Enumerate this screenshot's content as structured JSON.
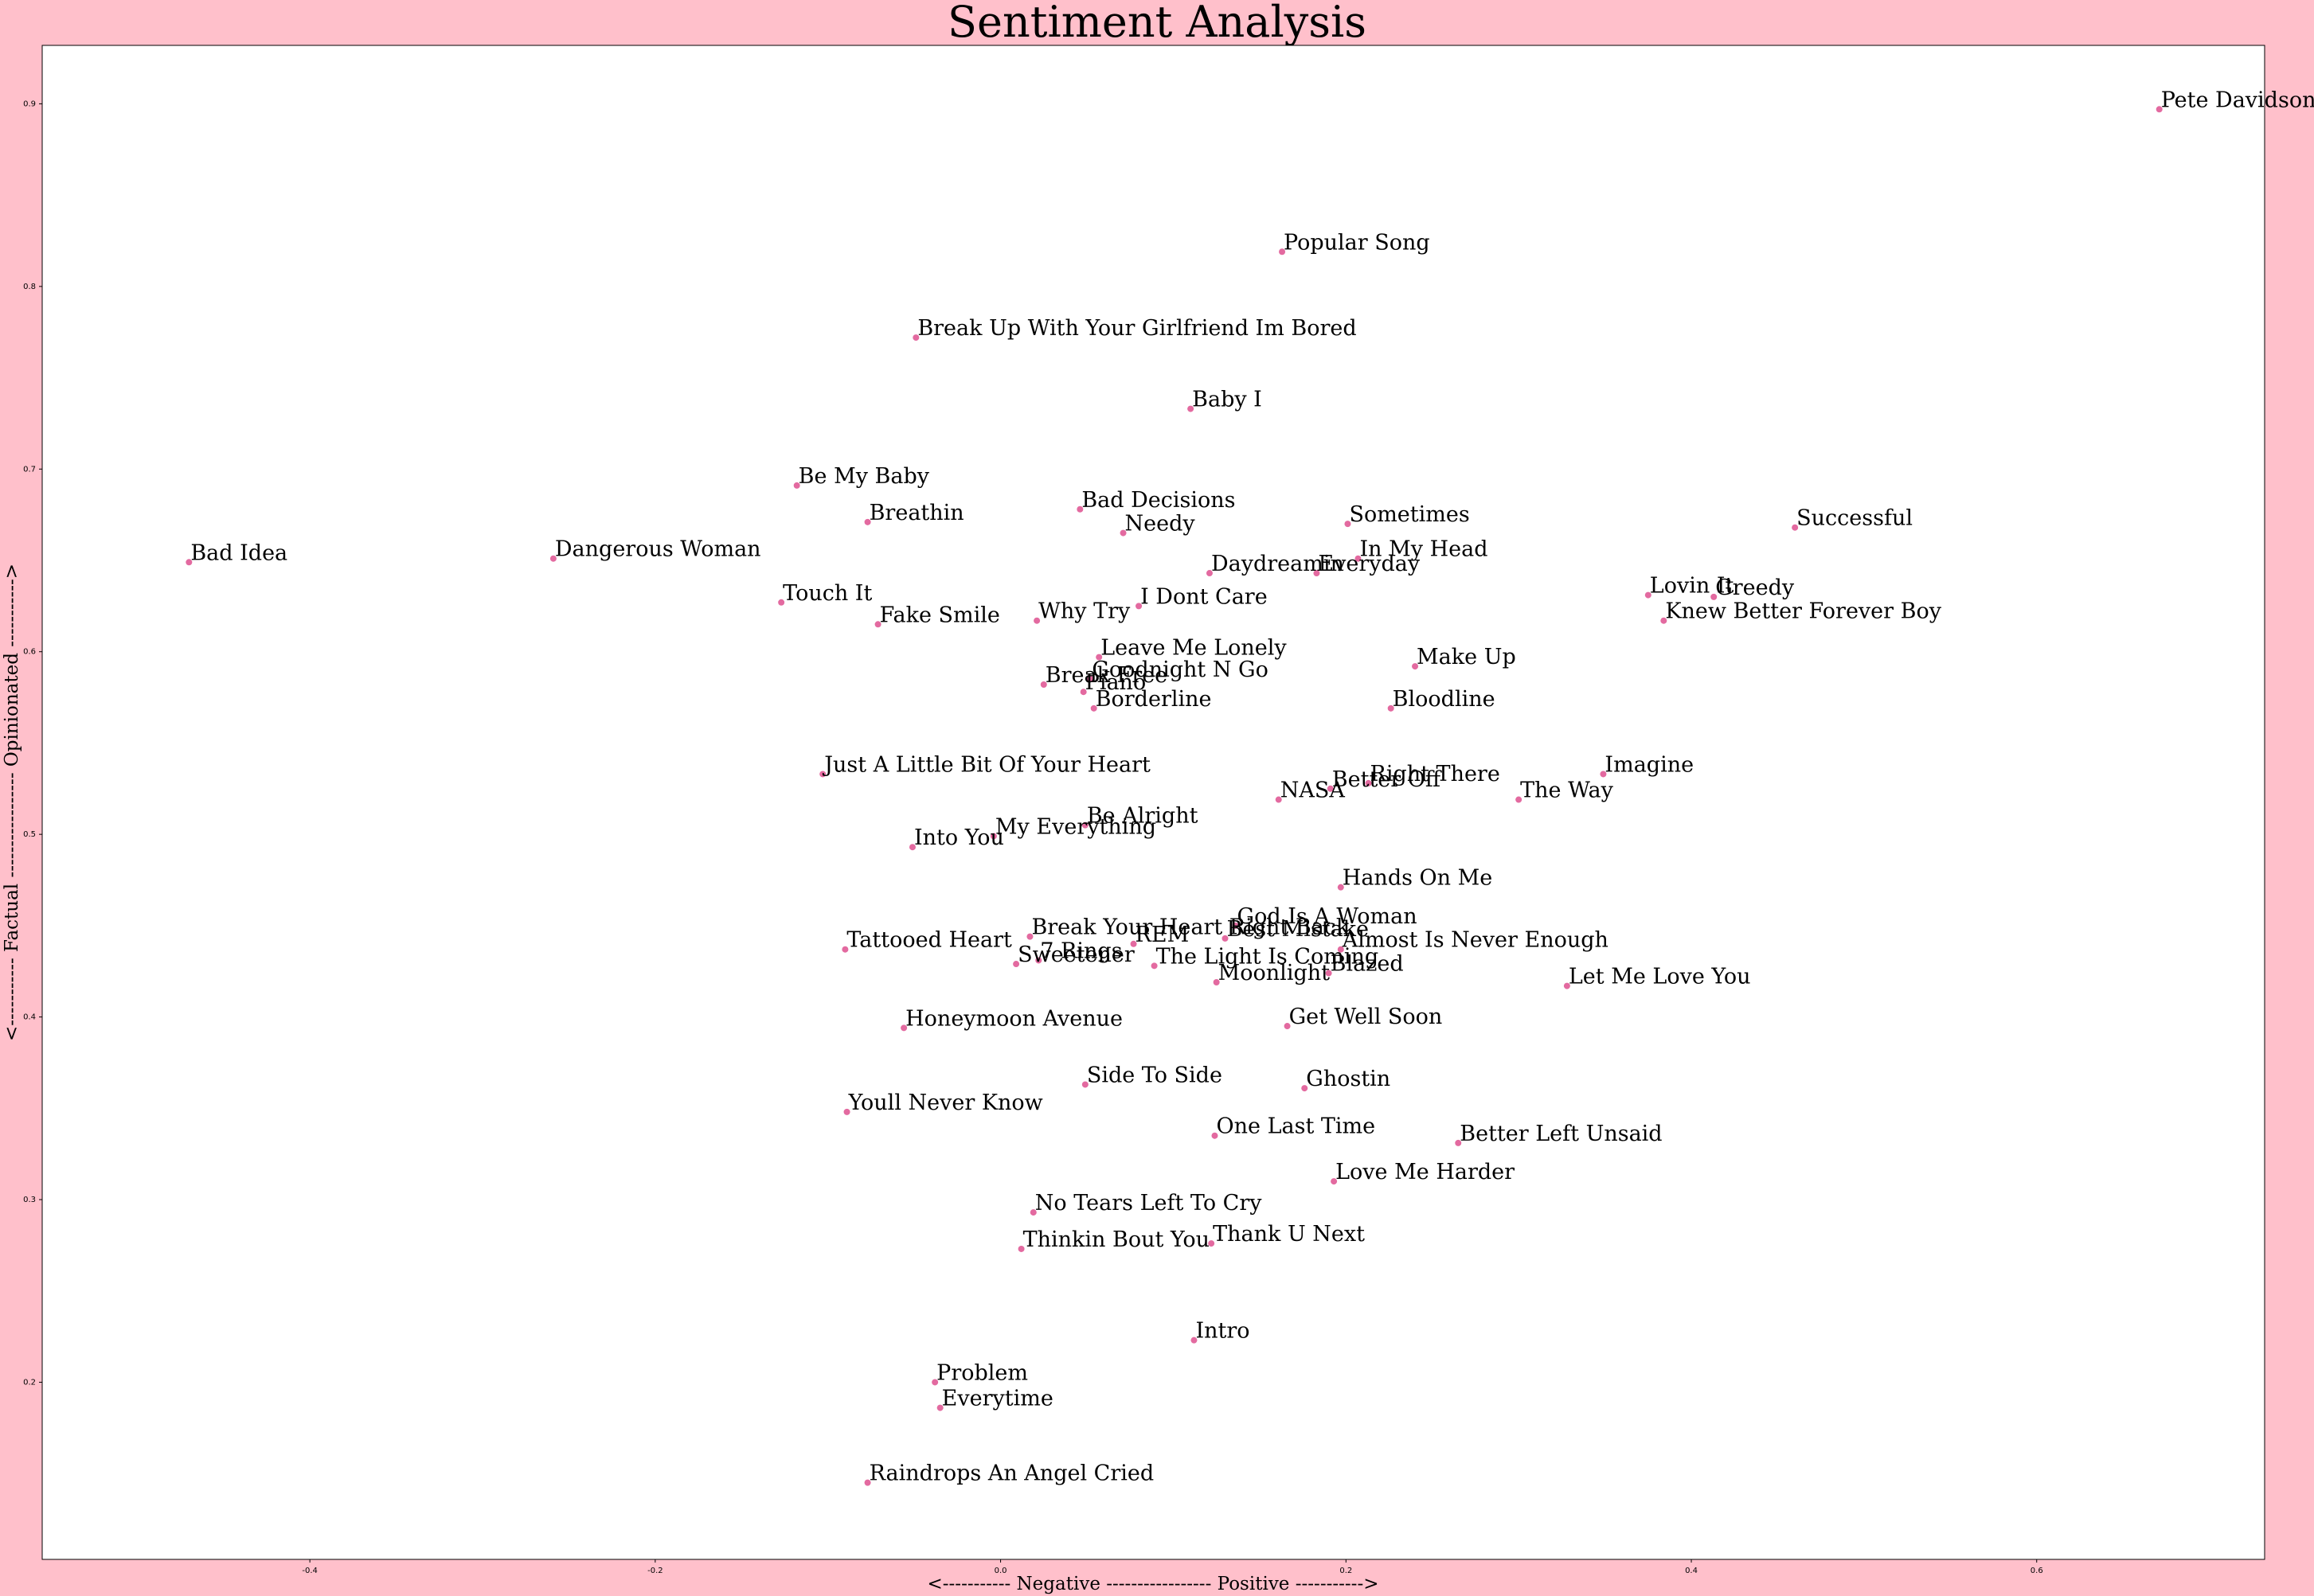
{
  "chart_data": {
    "type": "scatter",
    "title": "Sentiment Analysis",
    "xlabel": "<----------- Negative ----------------- Positive ----------->",
    "ylabel": "<----------- Factual ----------------- Opinionated ----------->",
    "xlim": [
      -0.555,
      0.732
    ],
    "ylim": [
      0.103,
      0.932
    ],
    "xticks": [
      -0.4,
      -0.2,
      0.0,
      0.2,
      0.4,
      0.6
    ],
    "xtick_labels": [
      "-0.4",
      "-0.2",
      "0.0",
      "0.2",
      "0.4",
      "0.6"
    ],
    "yticks": [
      0.2,
      0.3,
      0.4,
      0.5,
      0.6,
      0.7,
      0.8,
      0.9
    ],
    "ytick_labels": [
      "0.2",
      "0.3",
      "0.4",
      "0.5",
      "0.6",
      "0.7",
      "0.8",
      "0.9"
    ],
    "point_color": "#e36aa0",
    "background_color": "#ffc0cb",
    "plot_background": "#ffffff",
    "grid": false,
    "legend": false,
    "points": [
      {
        "label": "Pete Davidson",
        "x": 0.671,
        "y": 0.897
      },
      {
        "label": "Popular Song",
        "x": 0.163,
        "y": 0.819
      },
      {
        "label": "Break Up With Your Girlfriend Im Bored",
        "x": -0.049,
        "y": 0.772
      },
      {
        "label": "Baby I",
        "x": 0.11,
        "y": 0.733
      },
      {
        "label": "Be My Baby",
        "x": -0.118,
        "y": 0.691
      },
      {
        "label": "Breathin",
        "x": -0.077,
        "y": 0.671
      },
      {
        "label": "Bad Decisions",
        "x": 0.046,
        "y": 0.678
      },
      {
        "label": "Needy",
        "x": 0.071,
        "y": 0.665
      },
      {
        "label": "Sometimes",
        "x": 0.201,
        "y": 0.67
      },
      {
        "label": "Successful",
        "x": 0.46,
        "y": 0.668
      },
      {
        "label": "Bad Idea",
        "x": -0.47,
        "y": 0.649
      },
      {
        "label": "Dangerous Woman",
        "x": -0.259,
        "y": 0.651
      },
      {
        "label": "In My Head",
        "x": 0.207,
        "y": 0.651
      },
      {
        "label": "Daydreamin",
        "x": 0.121,
        "y": 0.643
      },
      {
        "label": "Everyday",
        "x": 0.183,
        "y": 0.643
      },
      {
        "label": "Touch It",
        "x": -0.127,
        "y": 0.627
      },
      {
        "label": "Fake Smile",
        "x": -0.071,
        "y": 0.615
      },
      {
        "label": "Why Try",
        "x": 0.021,
        "y": 0.617
      },
      {
        "label": "I Dont Care",
        "x": 0.08,
        "y": 0.625
      },
      {
        "label": "Lovin It",
        "x": 0.375,
        "y": 0.631
      },
      {
        "label": "Greedy",
        "x": 0.413,
        "y": 0.63
      },
      {
        "label": "Knew Better Forever Boy",
        "x": 0.384,
        "y": 0.617
      },
      {
        "label": "Leave Me Lonely",
        "x": 0.057,
        "y": 0.597
      },
      {
        "label": "Make Up",
        "x": 0.24,
        "y": 0.592
      },
      {
        "label": "Goodnight N Go",
        "x": 0.052,
        "y": 0.585
      },
      {
        "label": "Break Free",
        "x": 0.025,
        "y": 0.582
      },
      {
        "label": "Piano",
        "x": 0.048,
        "y": 0.578
      },
      {
        "label": "Bloodline",
        "x": 0.226,
        "y": 0.569
      },
      {
        "label": "Borderline",
        "x": 0.054,
        "y": 0.569
      },
      {
        "label": "Just A Little Bit Of Your Heart",
        "x": -0.103,
        "y": 0.533
      },
      {
        "label": "Imagine",
        "x": 0.349,
        "y": 0.533
      },
      {
        "label": "Right There",
        "x": 0.213,
        "y": 0.528
      },
      {
        "label": "Better Off",
        "x": 0.191,
        "y": 0.525
      },
      {
        "label": "NASA",
        "x": 0.161,
        "y": 0.519
      },
      {
        "label": "The Way",
        "x": 0.3,
        "y": 0.519
      },
      {
        "label": "Be Alright",
        "x": 0.049,
        "y": 0.505
      },
      {
        "label": "My Everything",
        "x": -0.004,
        "y": 0.499
      },
      {
        "label": "Into You",
        "x": -0.051,
        "y": 0.493
      },
      {
        "label": "Hands On Me",
        "x": 0.197,
        "y": 0.471
      },
      {
        "label": "God Is A Woman",
        "x": 0.136,
        "y": 0.45
      },
      {
        "label": "Break Your Heart Right Back",
        "x": 0.017,
        "y": 0.444
      },
      {
        "label": "Best Mistake",
        "x": 0.13,
        "y": 0.443
      },
      {
        "label": "REM",
        "x": 0.077,
        "y": 0.44
      },
      {
        "label": "Almost Is Never Enough",
        "x": 0.197,
        "y": 0.437
      },
      {
        "label": "Tattooed Heart",
        "x": -0.09,
        "y": 0.437
      },
      {
        "label": "7 Rings",
        "x": 0.022,
        "y": 0.431
      },
      {
        "label": "Sweetener",
        "x": 0.009,
        "y": 0.429
      },
      {
        "label": "The Light Is Coming",
        "x": 0.089,
        "y": 0.428
      },
      {
        "label": "Blazed",
        "x": 0.19,
        "y": 0.424
      },
      {
        "label": "Moonlight",
        "x": 0.125,
        "y": 0.419
      },
      {
        "label": "Let Me Love You",
        "x": 0.328,
        "y": 0.417
      },
      {
        "label": "Honeymoon Avenue",
        "x": -0.056,
        "y": 0.394
      },
      {
        "label": "Get Well Soon",
        "x": 0.166,
        "y": 0.395
      },
      {
        "label": "Side To Side",
        "x": 0.049,
        "y": 0.363
      },
      {
        "label": "Ghostin",
        "x": 0.176,
        "y": 0.361
      },
      {
        "label": "Youll Never Know",
        "x": -0.089,
        "y": 0.348
      },
      {
        "label": "One Last Time",
        "x": 0.124,
        "y": 0.335
      },
      {
        "label": "Better Left Unsaid",
        "x": 0.265,
        "y": 0.331
      },
      {
        "label": "Love Me Harder",
        "x": 0.193,
        "y": 0.31
      },
      {
        "label": "No Tears Left To Cry",
        "x": 0.019,
        "y": 0.293
      },
      {
        "label": "Thinkin Bout You",
        "x": 0.012,
        "y": 0.273
      },
      {
        "label": "Thank U Next",
        "x": 0.122,
        "y": 0.276
      },
      {
        "label": "Intro",
        "x": 0.112,
        "y": 0.223
      },
      {
        "label": "Problem",
        "x": -0.038,
        "y": 0.2
      },
      {
        "label": "Everytime",
        "x": -0.035,
        "y": 0.186
      },
      {
        "label": "Raindrops An Angel Cried",
        "x": -0.077,
        "y": 0.145
      }
    ]
  }
}
